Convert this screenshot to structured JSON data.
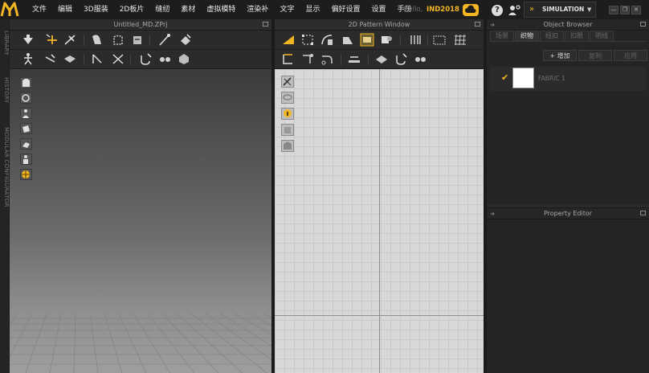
{
  "app": {
    "logo_icon": "marvelous-designer-logo-icon",
    "accent_color": "#f3b623"
  },
  "menu": {
    "items": [
      "文件",
      "编辑",
      "3D服装",
      "2D板片",
      "缝纫",
      "素材",
      "虚拟模特",
      "渲染补",
      "文字",
      "显示",
      "偏好设置",
      "设置",
      "手册"
    ]
  },
  "header": {
    "hello_label": "Hello,",
    "user_name": "IND2018",
    "help_label": "?",
    "mode": "SIMULATION",
    "mode_caret": "▼",
    "window_buttons": [
      "—",
      "❐",
      "✕"
    ]
  },
  "left_strip": {
    "tabs": [
      "LIBRARY",
      "HISTORY",
      "MODULAR CONFIGURATOR"
    ]
  },
  "window3d": {
    "title": "Untitled_MD.ZPrj"
  },
  "window2d": {
    "title": "2D Pattern Window"
  },
  "object_browser": {
    "title": "Object Browser",
    "tabs": [
      "场景",
      "织物",
      "纽扣",
      "扣眼",
      "明线"
    ],
    "active_tab": "织物",
    "actions": [
      "+ 增加",
      "复制",
      "应用"
    ],
    "fabric_items": [
      {
        "name": "FABRIC 1",
        "color": "#ffffff",
        "checked": true,
        "check": "✔"
      }
    ]
  },
  "property_editor": {
    "title": "Property Editor"
  }
}
